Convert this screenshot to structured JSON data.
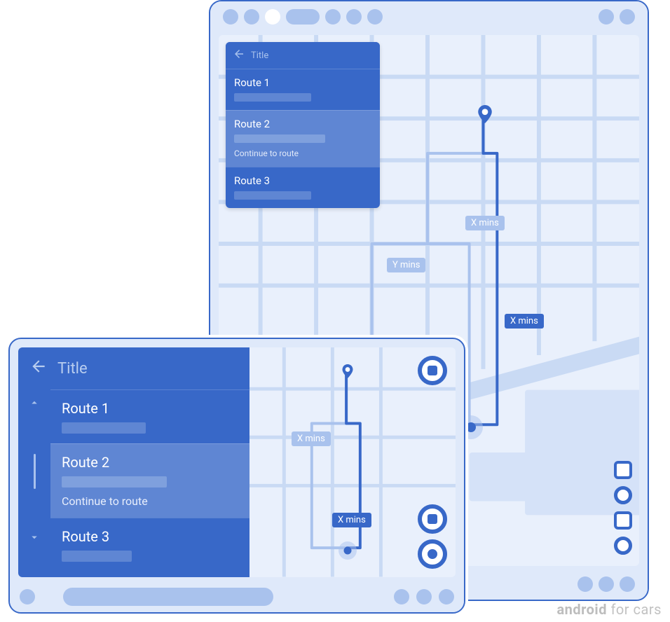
{
  "watermark": {
    "bold": "android",
    "rest": " for cars"
  },
  "portrait": {
    "panel": {
      "title": "Title",
      "items": [
        {
          "label": "Route 1"
        },
        {
          "label": "Route 2",
          "sub": "Continue to route"
        },
        {
          "label": "Route 3"
        }
      ]
    },
    "badges": {
      "primary": "X mins",
      "alt1": "X mins",
      "alt2": "Y mins"
    }
  },
  "landscape": {
    "panel": {
      "title": "Title",
      "items": [
        {
          "label": "Route 1"
        },
        {
          "label": "Route 2",
          "sub": "Continue to route"
        },
        {
          "label": "Route 3"
        }
      ]
    },
    "badges": {
      "primary": "X mins",
      "alt": "X mins"
    }
  }
}
